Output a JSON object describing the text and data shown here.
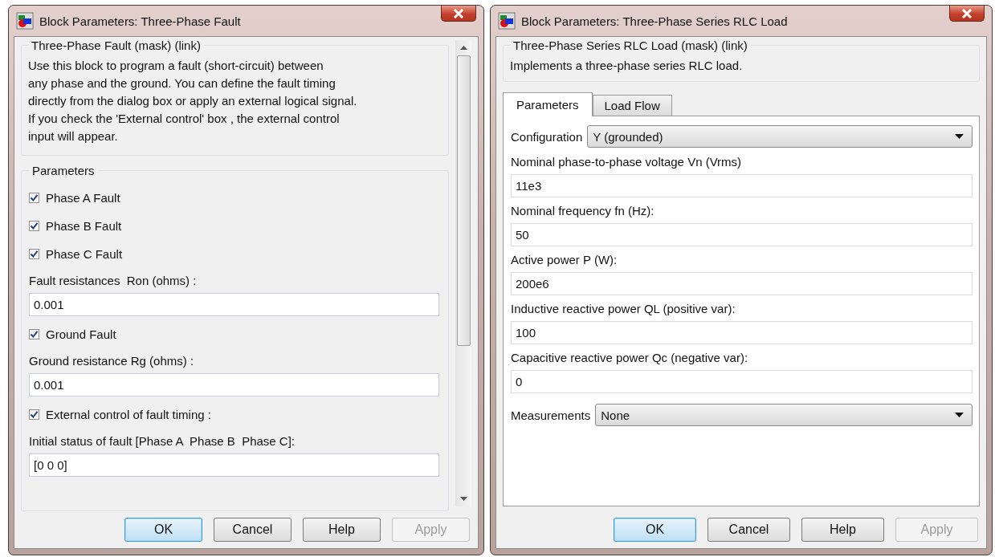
{
  "dialogs": [
    {
      "title": "Block Parameters: Three-Phase Fault",
      "mask_title": "Three-Phase Fault (mask) (link)",
      "description": "Use this block to program a fault (short-circuit) between\nany phase and the ground. You can define the fault timing\ndirectly from the dialog box or apply an external logical signal.\nIf you check the 'External control' box , the external control\ninput will appear.",
      "parameters_heading": "Parameters",
      "items": [
        {
          "kind": "checkbox",
          "label": "Phase A Fault",
          "checked": true
        },
        {
          "kind": "checkbox",
          "label": "Phase B Fault",
          "checked": true
        },
        {
          "kind": "checkbox",
          "label": "Phase C Fault",
          "checked": true
        },
        {
          "kind": "field",
          "label": "Fault resistances  Ron (ohms) :",
          "value": "0.001"
        },
        {
          "kind": "checkbox",
          "label": "Ground Fault",
          "checked": true
        },
        {
          "kind": "field",
          "label": "Ground resistance Rg (ohms) :",
          "value": "0.001"
        },
        {
          "kind": "checkbox",
          "label": "External control of fault timing :",
          "checked": true
        },
        {
          "kind": "field",
          "label": "Initial status of fault [Phase A  Phase B  Phase C]:",
          "value": "[0 0 0]"
        }
      ],
      "buttons": [
        {
          "label": "OK",
          "default": true,
          "disabled": false
        },
        {
          "label": "Cancel",
          "default": false,
          "disabled": false
        },
        {
          "label": "Help",
          "default": false,
          "disabled": false
        },
        {
          "label": "Apply",
          "default": false,
          "disabled": true
        }
      ]
    },
    {
      "title": "Block Parameters: Three-Phase Series RLC Load",
      "mask_title": "Three-Phase Series RLC Load (mask) (link)",
      "description": "Implements a three-phase series RLC load.",
      "tabs": [
        {
          "label": "Parameters",
          "selected": true
        },
        {
          "label": "Load Flow",
          "selected": false
        }
      ],
      "items": [
        {
          "kind": "select",
          "label": "Configuration",
          "value": "Y (grounded)"
        },
        {
          "kind": "field",
          "label": "Nominal phase-to-phase voltage Vn (Vrms)",
          "value": "11e3"
        },
        {
          "kind": "field",
          "label": "Nominal frequency fn (Hz):",
          "value": "50"
        },
        {
          "kind": "field",
          "label": "Active power P (W):",
          "value": "200e6"
        },
        {
          "kind": "field",
          "label": "Inductive reactive power QL (positive var):",
          "value": "100"
        },
        {
          "kind": "field",
          "label": "Capacitive reactive power Qc (negative var):",
          "value": "0"
        },
        {
          "kind": "select",
          "label": "Measurements",
          "value": "None"
        }
      ],
      "buttons": [
        {
          "label": "OK",
          "default": true,
          "disabled": false
        },
        {
          "label": "Cancel",
          "default": false,
          "disabled": false
        },
        {
          "label": "Help",
          "default": false,
          "disabled": false
        },
        {
          "label": "Apply",
          "default": false,
          "disabled": true
        }
      ]
    }
  ]
}
